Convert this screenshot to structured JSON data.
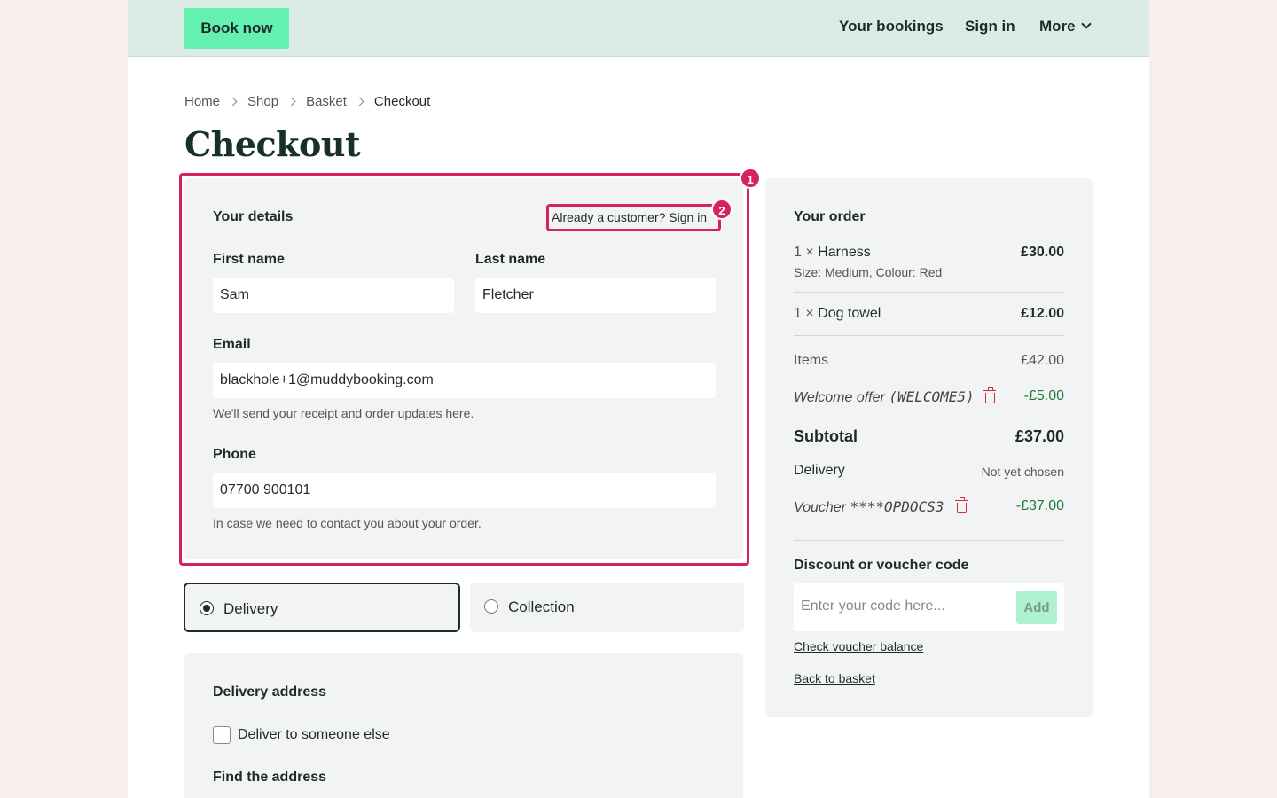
{
  "header": {
    "book_now": "Book now",
    "nav": {
      "bookings": "Your bookings",
      "signin": "Sign in",
      "more": "More"
    }
  },
  "breadcrumb": [
    "Home",
    "Shop",
    "Basket",
    "Checkout"
  ],
  "page_title": "Checkout",
  "details": {
    "title": "Your details",
    "signin_link": "Already a customer? Sign in",
    "first_name_label": "First name",
    "first_name_value": "Sam",
    "last_name_label": "Last name",
    "last_name_value": "Fletcher",
    "email_label": "Email",
    "email_value": "blackhole+1@muddybooking.com",
    "email_help": "We'll send your receipt and order updates here.",
    "phone_label": "Phone",
    "phone_value": "07700 900101",
    "phone_help": "In case we need to contact you about your order."
  },
  "annotations": {
    "badge1": "1",
    "badge2": "2"
  },
  "fulfilment": {
    "delivery": "Delivery",
    "collection": "Collection",
    "selected": "delivery"
  },
  "address": {
    "title": "Delivery address",
    "deliver_someone_else": "Deliver to someone else",
    "find_label": "Find the address"
  },
  "order": {
    "title": "Your order",
    "items": [
      {
        "qty": "1 ×",
        "name": "Harness",
        "price": "£30.00",
        "meta": "Size: Medium, Colour: Red"
      },
      {
        "qty": "1 ×",
        "name": "Dog towel",
        "price": "£12.00"
      }
    ],
    "items_label": "Items",
    "items_total": "£42.00",
    "offer_label": "Welcome offer",
    "offer_code": "(WELCOME5)",
    "offer_value": "-£5.00",
    "subtotal_label": "Subtotal",
    "subtotal_value": "£37.00",
    "delivery_label": "Delivery",
    "delivery_value": "Not yet chosen",
    "voucher_label": "Voucher",
    "voucher_code": "****OPDOCS3",
    "voucher_value": "-£37.00",
    "discount_title": "Discount or voucher code",
    "code_placeholder": "Enter your code here...",
    "add_button": "Add",
    "check_balance": "Check voucher balance",
    "back_to_basket": "Back to basket"
  },
  "colors": {
    "accent": "#64f0b0",
    "highlight": "#d6245a",
    "header_bg": "#d9ebe4",
    "discount_green": "#1f7a3a"
  }
}
